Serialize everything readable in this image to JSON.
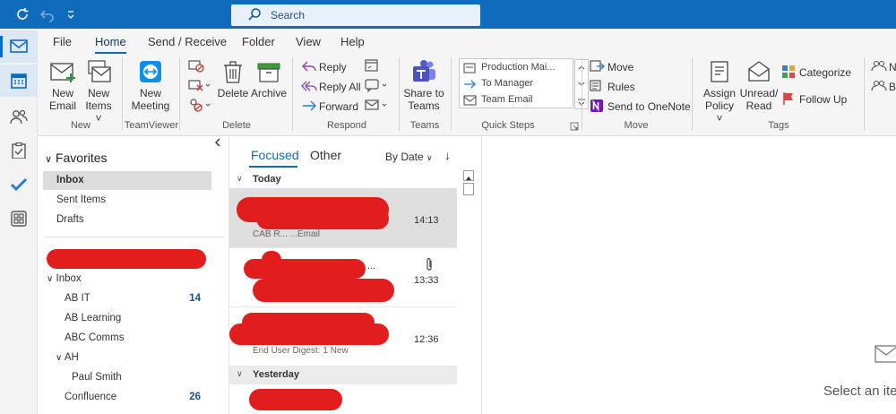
{
  "titlebar": {
    "search_placeholder": "Search"
  },
  "menu": {
    "tabs": [
      "File",
      "Home",
      "Send / Receive",
      "Folder",
      "View",
      "Help"
    ],
    "active": "Home"
  },
  "ribbon": {
    "new": {
      "new_email": [
        "New",
        "Email"
      ],
      "new_items": [
        "New",
        "Items ˅"
      ],
      "group": "New"
    },
    "teamviewer": {
      "new_meeting": [
        "New",
        "Meeting"
      ],
      "group": "TeamViewer"
    },
    "delete": {
      "delete": "Delete",
      "archive": "Archive",
      "group": "Delete"
    },
    "respond": {
      "reply": "Reply",
      "reply_all": "Reply All",
      "forward": "Forward",
      "group": "Respond"
    },
    "teams": {
      "share": [
        "Share to",
        "Teams"
      ],
      "group": "Teams"
    },
    "quick_steps": {
      "items": [
        "Production Mai...",
        "To Manager",
        "Team Email"
      ],
      "group": "Quick Steps"
    },
    "move": {
      "move": "Move",
      "rules": "Rules",
      "onenote": "Send to OneNote",
      "group": "Move"
    },
    "tags": {
      "assign": [
        "Assign",
        "Policy ˅"
      ],
      "unread": [
        "Unread/",
        "Read"
      ],
      "categorize": "Categorize",
      "followup": "Follow Up",
      "group": "Tags"
    },
    "cut": {
      "n1": "N",
      "n2": "B"
    }
  },
  "folders": {
    "favorites_header": "Favorites",
    "favorites": [
      "Inbox",
      "Sent Items",
      "Drafts"
    ],
    "inbox_header": "Inbox",
    "subfolders": [
      {
        "name": "AB IT",
        "count": "14"
      },
      {
        "name": "AB Learning",
        "count": ""
      },
      {
        "name": "ABC Comms",
        "count": ""
      },
      {
        "name": "AH",
        "count": ""
      },
      {
        "name": "Paul Smith",
        "count": ""
      },
      {
        "name": "Confluence",
        "count": "26"
      }
    ]
  },
  "messages": {
    "tab_focused": "Focused",
    "tab_other": "Other",
    "sort": "By Date",
    "group_today": "Today",
    "group_yesterday": "Yesterday",
    "items": [
      {
        "time": "14:13",
        "preview": "CAB R... ...Email"
      },
      {
        "time": "13:33",
        "preview": "..."
      },
      {
        "time": "12:36",
        "preview": "End User Digest: 1 New"
      }
    ]
  },
  "reading": {
    "placeholder": "Select an ite"
  },
  "colors": {
    "brand": "#0f6cbd",
    "redaction": "#e21d1d"
  }
}
